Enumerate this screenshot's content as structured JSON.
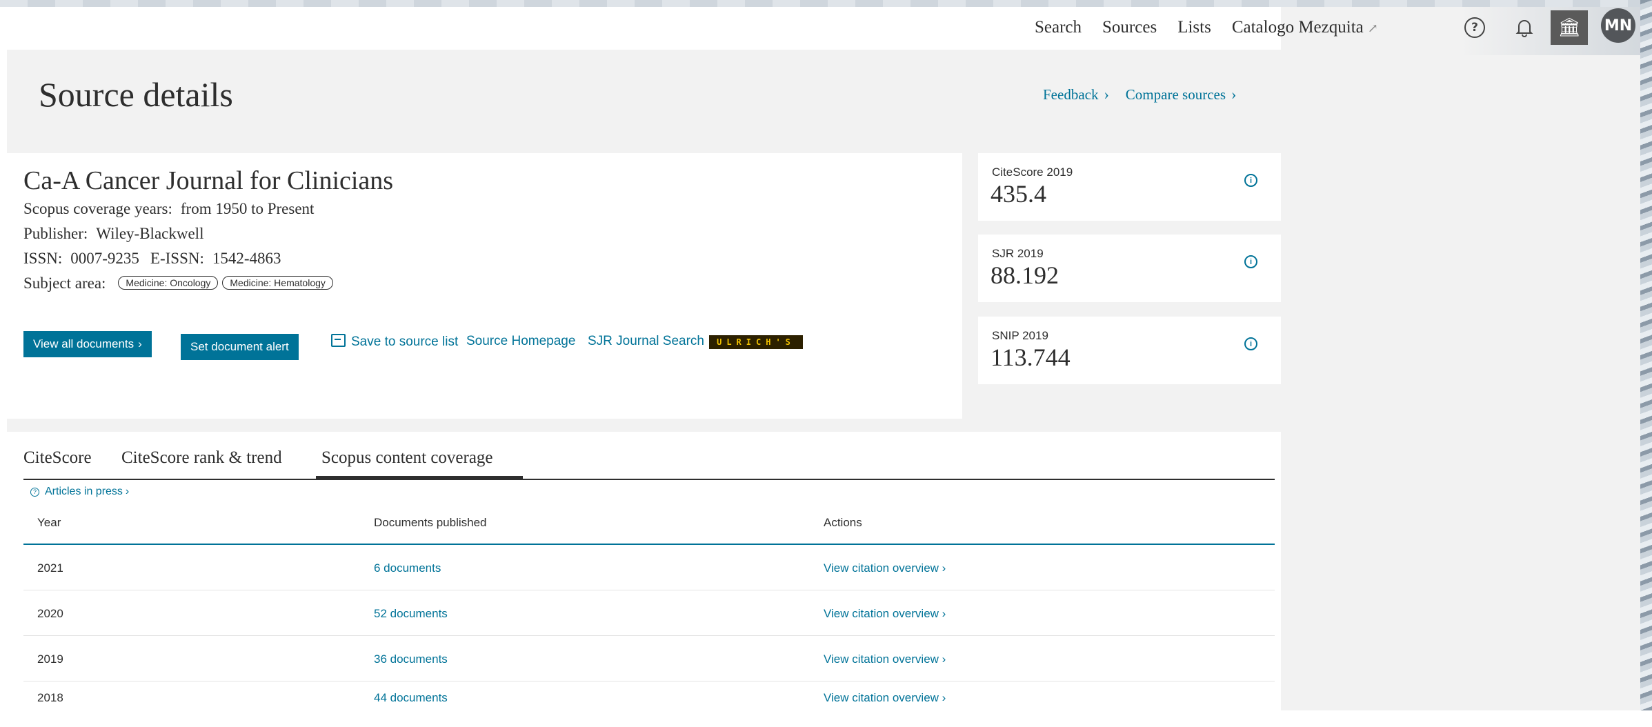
{
  "nav": {
    "items": [
      "Search",
      "Sources",
      "Lists"
    ],
    "external_link": "Catalogo Mezquita",
    "avatar_initials": "MN"
  },
  "page": {
    "title": "Source details",
    "feedback_label": "Feedback",
    "compare_label": "Compare sources"
  },
  "journal": {
    "title": "Ca-A Cancer Journal for Clinicians",
    "coverage_label": "Scopus coverage years:",
    "coverage_value": "from 1950 to Present",
    "publisher_label": "Publisher:",
    "publisher_value": "Wiley-Blackwell",
    "issn_label": "ISSN:",
    "issn_value": "0007-9235",
    "eissn_label": "E-ISSN:",
    "eissn_value": "1542-4863",
    "subject_label": "Subject area:",
    "subjects": [
      "Medicine: Oncology",
      "Medicine: Hematology"
    ]
  },
  "actions": {
    "view_all_documents": "View all documents",
    "set_alert": "Set document alert",
    "save_to_list": "Save to source list",
    "source_homepage": "Source Homepage",
    "sjr_search": "SJR Journal Search",
    "ulrichs": "ULRICH'S"
  },
  "metrics": [
    {
      "label": "CiteScore 2019",
      "value": "435.4"
    },
    {
      "label": "SJR 2019",
      "value": "88.192"
    },
    {
      "label": "SNIP 2019",
      "value": "113.744"
    }
  ],
  "tabs": {
    "items": [
      "CiteScore",
      "CiteScore rank & trend",
      "Scopus content coverage"
    ],
    "active_index": 2
  },
  "coverage": {
    "articles_in_press": "Articles in press",
    "headers": {
      "year": "Year",
      "docs": "Documents published",
      "actions": "Actions"
    },
    "rows": [
      {
        "year": "2021",
        "docs": "6 documents",
        "action": "View citation overview"
      },
      {
        "year": "2020",
        "docs": "52 documents",
        "action": "View citation overview"
      },
      {
        "year": "2019",
        "docs": "36 documents",
        "action": "View citation overview"
      },
      {
        "year": "2018",
        "docs": "44 documents",
        "action": "View citation overview"
      }
    ]
  },
  "colors": {
    "accent": "#007398",
    "panel": "#f2f2f2",
    "text": "#2e2e2e"
  }
}
